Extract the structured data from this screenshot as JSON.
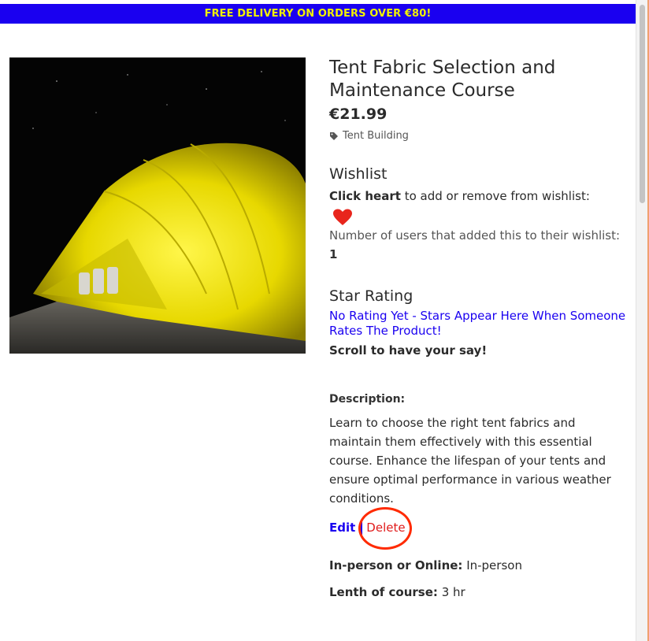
{
  "banner": {
    "text": "FREE DELIVERY ON ORDERS OVER €80!"
  },
  "product": {
    "title": "Tent Fabric Selection and Maintenance Course",
    "price": "€21.99",
    "category": "Tent Building",
    "image_alt": "Yellow tent lit at night"
  },
  "wishlist": {
    "heading": "Wishlist",
    "click_bold": "Click heart",
    "click_rest": " to add or remove from wishlist:",
    "count_label": "Number of users that added this to their wishlist: ",
    "count": "1"
  },
  "rating": {
    "heading": "Star Rating",
    "no_rating": "No Rating Yet - Stars Appear Here When Someone Rates The Product!",
    "cta": "Scroll to have your say!"
  },
  "description": {
    "heading": "Description:",
    "text": "Learn to choose the right tent fabrics and maintain them effectively with this essential course. Enhance the lifespan of your tents and ensure optimal performance in various weather conditions."
  },
  "actions": {
    "edit": "Edit",
    "delete": "Delete"
  },
  "details": {
    "mode_label": "In-person or Online:",
    "mode_value": " In-person",
    "length_label": "Lenth of course:",
    "length_value": " 3 hr"
  },
  "colors": {
    "banner_bg": "#1a00f0",
    "banner_text": "#f2f200",
    "accent": "#1a00f0",
    "danger": "#e01a1a",
    "heart": "#e8251c"
  },
  "icons": {
    "tag": "tag-icon",
    "heart": "heart-icon"
  }
}
